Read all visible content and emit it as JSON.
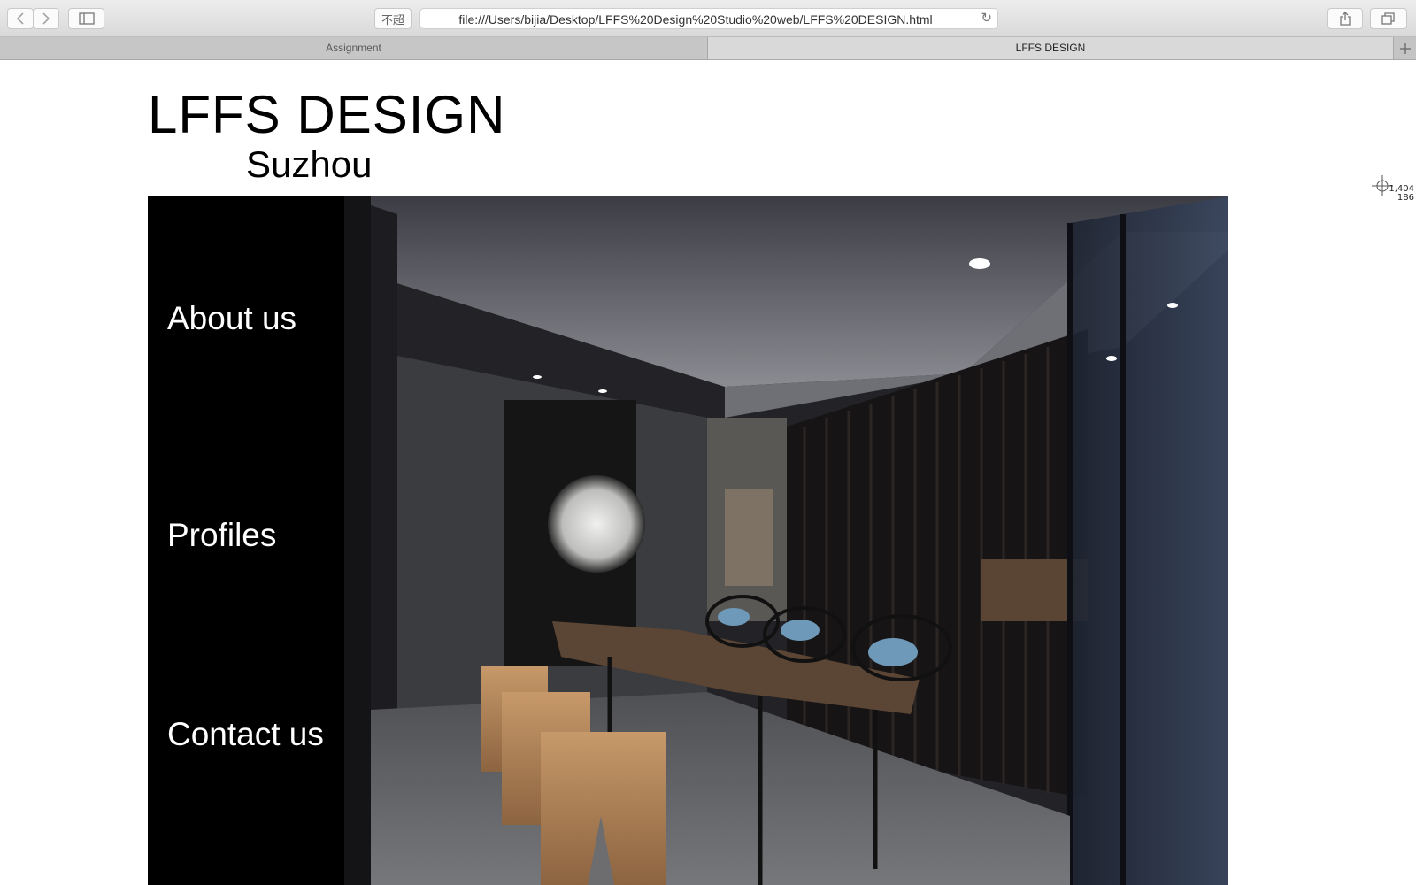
{
  "browser": {
    "url": "file:///Users/bijia/Desktop/LFFS%20Design%20Studio%20web/LFFS%20DESIGN.html",
    "reader_label": "不超",
    "tabs": [
      {
        "label": "Assignment",
        "active": false
      },
      {
        "label": "LFFS DESIGN",
        "active": true
      }
    ]
  },
  "page": {
    "logo_title": "LFFS DESIGN",
    "logo_subtitle": "Suzhou",
    "nav": [
      {
        "label": "About us"
      },
      {
        "label": "Profiles"
      },
      {
        "label": "Contact us"
      }
    ]
  },
  "overlay": {
    "cursor_x": "1,404",
    "cursor_y": "186"
  },
  "colors": {
    "sidebar_bg": "#000000",
    "nav_text": "#ffffff",
    "page_bg": "#ffffff"
  },
  "icons": [
    "back-arrow-icon",
    "forward-arrow-icon",
    "sidebar-icon",
    "reload-icon",
    "share-icon",
    "tabs-overview-icon",
    "new-tab-plus-icon",
    "crosshair-icon"
  ]
}
